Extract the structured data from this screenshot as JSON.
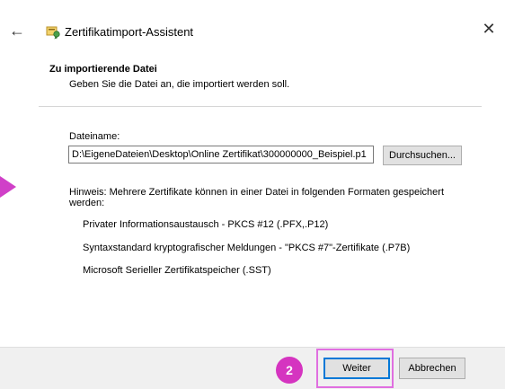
{
  "window": {
    "title": "Zertifikatimport-Assistent",
    "back_icon": "←",
    "close_icon": "✕"
  },
  "section": {
    "title": "Zu importierende Datei",
    "subtitle": "Geben Sie die Datei an, die importiert werden soll."
  },
  "file": {
    "label": "Dateiname:",
    "value": "D:\\EigeneDateien\\Desktop\\Online Zertifikat\\300000000_Beispiel.p1",
    "browse_label": "Durchsuchen..."
  },
  "hint": {
    "line1": "Hinweis: Mehrere Zertifikate können in einer Datei in folgenden Formaten gespeichert",
    "line2": "werden:"
  },
  "formats": [
    "Privater Informationsaustausch - PKCS #12 (.PFX,.P12)",
    "Syntaxstandard kryptografischer Meldungen - \"PKCS #7\"-Zertifikate (.P7B)",
    "Microsoft Serieller Zertifikatspeicher (.SST)"
  ],
  "footer": {
    "step_badge": "2",
    "next_label": "Weiter",
    "cancel_label": "Abbrechen"
  },
  "colors": {
    "annotation": "#d534c0",
    "accent": "#0078d7"
  }
}
